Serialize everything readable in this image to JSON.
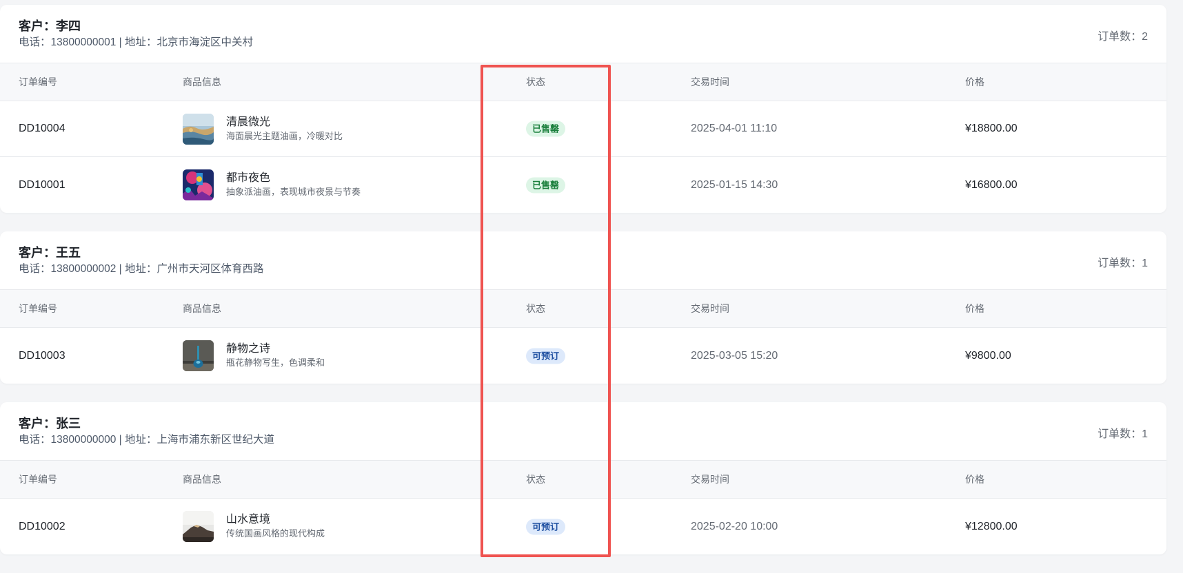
{
  "highlight_color": "#ef5350",
  "customers": [
    {
      "name": "客户：李四",
      "info": "电话：13800000001 | 地址：北京市海淀区中关村",
      "order_count": "订单数：2",
      "columns": [
        "订单编号",
        "商品信息",
        "状态",
        "交易时间",
        "价格"
      ],
      "orders": [
        {
          "id": "DD10004",
          "goods_name": "清晨微光",
          "goods_desc": "海面晨光主题油画，冷暖对比",
          "thumb": "seascape-thumbnail",
          "status": "已售罄",
          "status_type": "sold",
          "time": "2025-04-01 11:10",
          "price": "¥18800.00"
        },
        {
          "id": "DD10001",
          "goods_name": "都市夜色",
          "goods_desc": "抽象派油画，表现城市夜景与节奏",
          "thumb": "abstract-city-thumbnail",
          "status": "已售罄",
          "status_type": "sold",
          "time": "2025-01-15 14:30",
          "price": "¥16800.00"
        }
      ]
    },
    {
      "name": "客户：王五",
      "info": "电话：13800000002 | 地址：广州市天河区体育西路",
      "order_count": "订单数：1",
      "columns": [
        "订单编号",
        "商品信息",
        "状态",
        "交易时间",
        "价格"
      ],
      "orders": [
        {
          "id": "DD10003",
          "goods_name": "静物之诗",
          "goods_desc": "瓶花静物写生，色调柔和",
          "thumb": "vase-still-life-thumbnail",
          "status": "可预订",
          "status_type": "bookable",
          "time": "2025-03-05 15:20",
          "price": "¥9800.00"
        }
      ]
    },
    {
      "name": "客户：张三",
      "info": "电话：13800000000 | 地址：上海市浦东新区世纪大道",
      "order_count": "订单数：1",
      "columns": [
        "订单编号",
        "商品信息",
        "状态",
        "交易时间",
        "价格"
      ],
      "orders": [
        {
          "id": "DD10002",
          "goods_name": "山水意境",
          "goods_desc": "传统国画风格的现代构成",
          "thumb": "mountain-landscape-thumbnail",
          "status": "可预订",
          "status_type": "bookable",
          "time": "2025-02-20 10:00",
          "price": "¥12800.00"
        }
      ]
    }
  ]
}
